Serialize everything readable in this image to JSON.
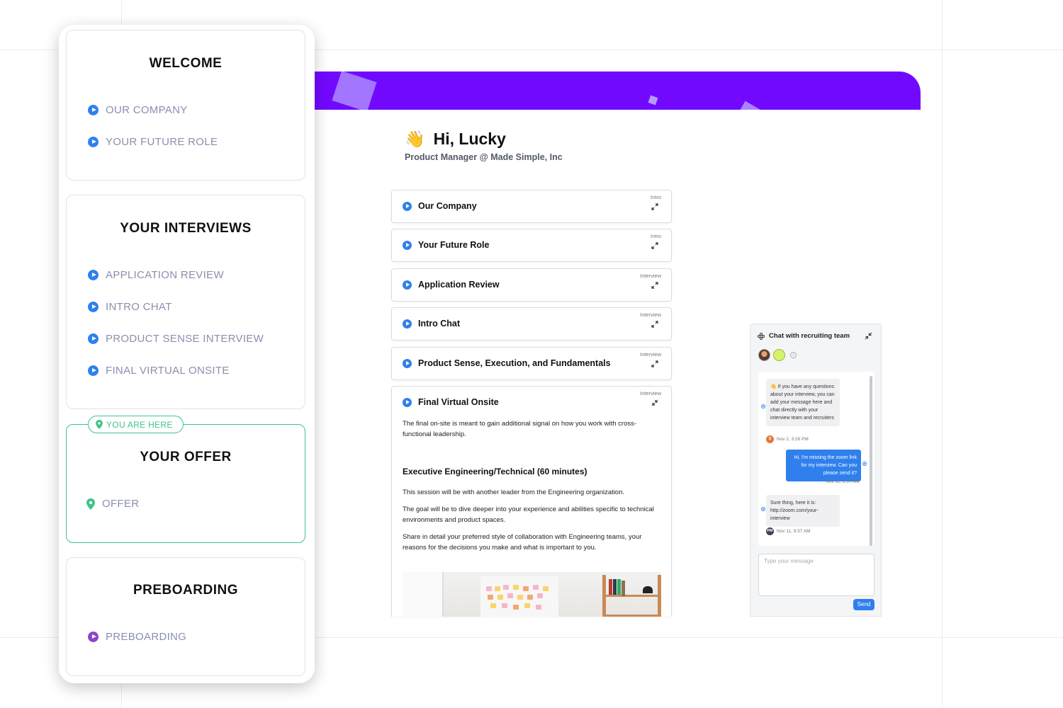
{
  "sidebar": {
    "welcome": {
      "title": "WELCOME",
      "items": [
        {
          "label": "OUR COMPANY"
        },
        {
          "label": "YOUR FUTURE ROLE"
        }
      ]
    },
    "interviews": {
      "title": "YOUR INTERVIEWS",
      "items": [
        {
          "label": "APPLICATION REVIEW"
        },
        {
          "label": "INTRO CHAT"
        },
        {
          "label": "PRODUCT SENSE INTERVIEW"
        },
        {
          "label": "FINAL VIRTUAL ONSITE"
        }
      ]
    },
    "offer": {
      "badge": "YOU ARE HERE",
      "title": "YOUR OFFER",
      "items": [
        {
          "label": "OFFER"
        }
      ]
    },
    "preboarding": {
      "title": "PREBOARDING",
      "items": [
        {
          "label": "PREBOARDING"
        }
      ]
    }
  },
  "main": {
    "greeting": "Hi, Lucky",
    "wave_emoji": "👋",
    "subtitle": "Product Manager @ Made Simple, Inc",
    "steps": [
      {
        "title": "Our Company",
        "tag": "Intro"
      },
      {
        "title": "Your Future Role",
        "tag": "Intro"
      },
      {
        "title": "Application Review",
        "tag": "Interview"
      },
      {
        "title": "Intro Chat",
        "tag": "Interview"
      },
      {
        "title": "Product Sense, Execution, and Fundamentals",
        "tag": "Interview"
      },
      {
        "title": "Final Virtual Onsite",
        "tag": "Interview",
        "intro": "The final on-site is meant to gain additional signal on how you work with cross-functional leadership.",
        "section_heading": "Executive Engineering/Technical (60 minutes)",
        "paragraphs": [
          "This session will be with another leader from the Engineering organization.",
          "The goal will be to dive deeper into your experience and abilities specific to technical environments and product spaces.",
          "Share in detail your preferred style of collaboration with Engineering teams, your reasons for the decisions you make and what is important to you."
        ]
      }
    ]
  },
  "chat": {
    "title": "Chat with recruiting team",
    "messages": [
      {
        "text": "👋 If you have any questions about your interview, you can add your message here and chat directly with your interview team and recruiters",
        "sender_initial": "S",
        "time": "Nov 2, 3:26 PM"
      },
      {
        "text": "Hi, I'm missing the zoom link for my interview. Can you please send it?",
        "time": "Nov 11, 9:37 AM"
      },
      {
        "text": "Sure thing, here it is: http://zoom.com/your-interview",
        "sender_initial": "PM",
        "time": "Nov 11, 9:37 AM"
      }
    ],
    "input_placeholder": "Type your message",
    "send_label": "Send"
  },
  "colors": {
    "brand_purple": "#7209ff",
    "accent_blue": "#2f80ed",
    "current_green": "#3cc487"
  }
}
